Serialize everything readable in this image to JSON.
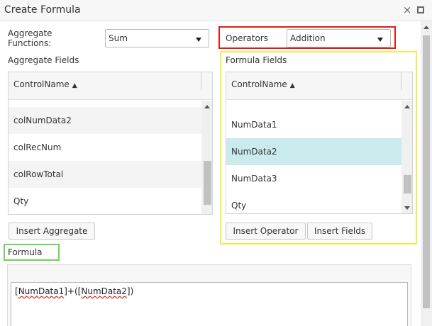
{
  "window": {
    "title": "Create Formula",
    "close_icon": "×"
  },
  "aggregate": {
    "functions_label_line1": "Aggregate",
    "functions_label_line2": "Functions:",
    "functions_value": "Sum",
    "fields_label": "Aggregate Fields",
    "header": "ControlName",
    "sort_indicator": "▲",
    "rows": [
      "colNumData2",
      "colRecNum",
      "colRowTotal",
      "Qty"
    ],
    "insert_button": "Insert Aggregate"
  },
  "operators": {
    "label": "Operators",
    "value": "Addition"
  },
  "formula_fields": {
    "label": "Formula Fields",
    "header": "ControlName",
    "sort_indicator": "▲",
    "rows": [
      "NumData1",
      "NumData2",
      "NumData3",
      "Qty"
    ],
    "selected_index": 1,
    "insert_operator_button": "Insert Operator",
    "insert_fields_button": "Insert Fields"
  },
  "formula": {
    "label": "Formula",
    "parts": [
      "[",
      "NumData1",
      "]+([",
      "NumData2",
      "])"
    ]
  },
  "colors": {
    "operators_highlight": "#e31b1b",
    "formula_fields_highlight": "#f2ef3c",
    "formula_label_highlight": "#6dd35a",
    "selected_row": "#c9ebee"
  }
}
